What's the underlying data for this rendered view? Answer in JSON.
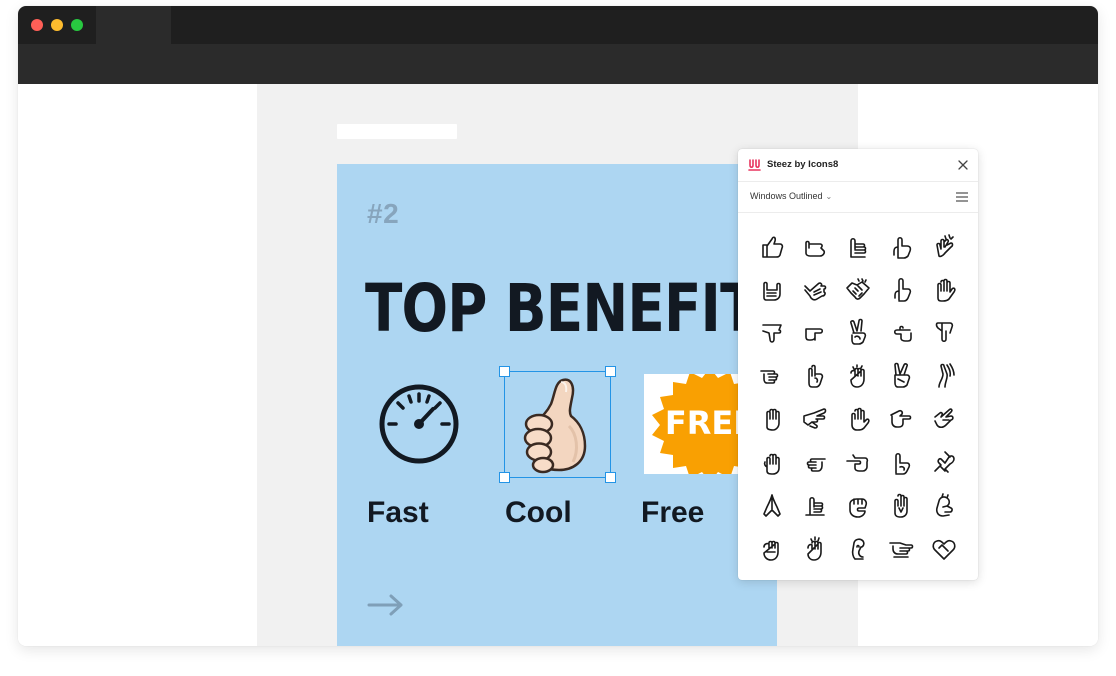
{
  "browser": {
    "controls": [
      "close",
      "minimize",
      "maximize"
    ]
  },
  "artboard": {
    "number": "#2",
    "headline": "TOP BENEFITS",
    "benefits": [
      {
        "label": "Fast",
        "icon": "speedometer-icon"
      },
      {
        "label": "Cool",
        "icon": "thumbs-up-icon"
      },
      {
        "label": "Free",
        "icon": "free-badge-icon",
        "badge_text": "FREE"
      }
    ],
    "arrow_icon": "arrow-right-icon"
  },
  "panel": {
    "title": "Steez by Icons8",
    "style_select": "Windows Outlined",
    "icons": [
      "thumbs-up-icon",
      "call-me-hand-icon",
      "hand-ok-icon",
      "hand-pointing-up-icon",
      "clapping-icon",
      "rock-on-icon",
      "shaka-icon",
      "handshake-icon",
      "pointing-up-icon",
      "open-hand-icon",
      "thumbs-down-icon",
      "pointing-right-icon",
      "victory-hand-icon",
      "pointing-left-icon",
      "pointing-down-icon",
      "pointing-finger-icon",
      "hand-peace-icon",
      "fist-icon",
      "victory-icon",
      "hand-wave-icon",
      "raised-hand-icon",
      "pinch-hand-icon",
      "stop-hand-icon",
      "point-right-icon",
      "love-you-hand-icon",
      "palm-icon",
      "point-left-icon",
      "finger-gun-icon",
      "index-finger-icon",
      "broken-heart-hand-icon",
      "praying-hands-icon",
      "hand-holding-icon",
      "closed-fist-icon",
      "crossed-fingers-icon",
      "grab-hand-icon",
      "raised-fist-icon",
      "fist-bump-icon",
      "hand-cursor-icon",
      "hand-pointing-icon",
      "heart-hands-icon"
    ]
  },
  "colors": {
    "artboard_bg": "#add6f2",
    "headline": "#121922",
    "selection": "#2394e6",
    "free_badge": "#f9a002"
  }
}
